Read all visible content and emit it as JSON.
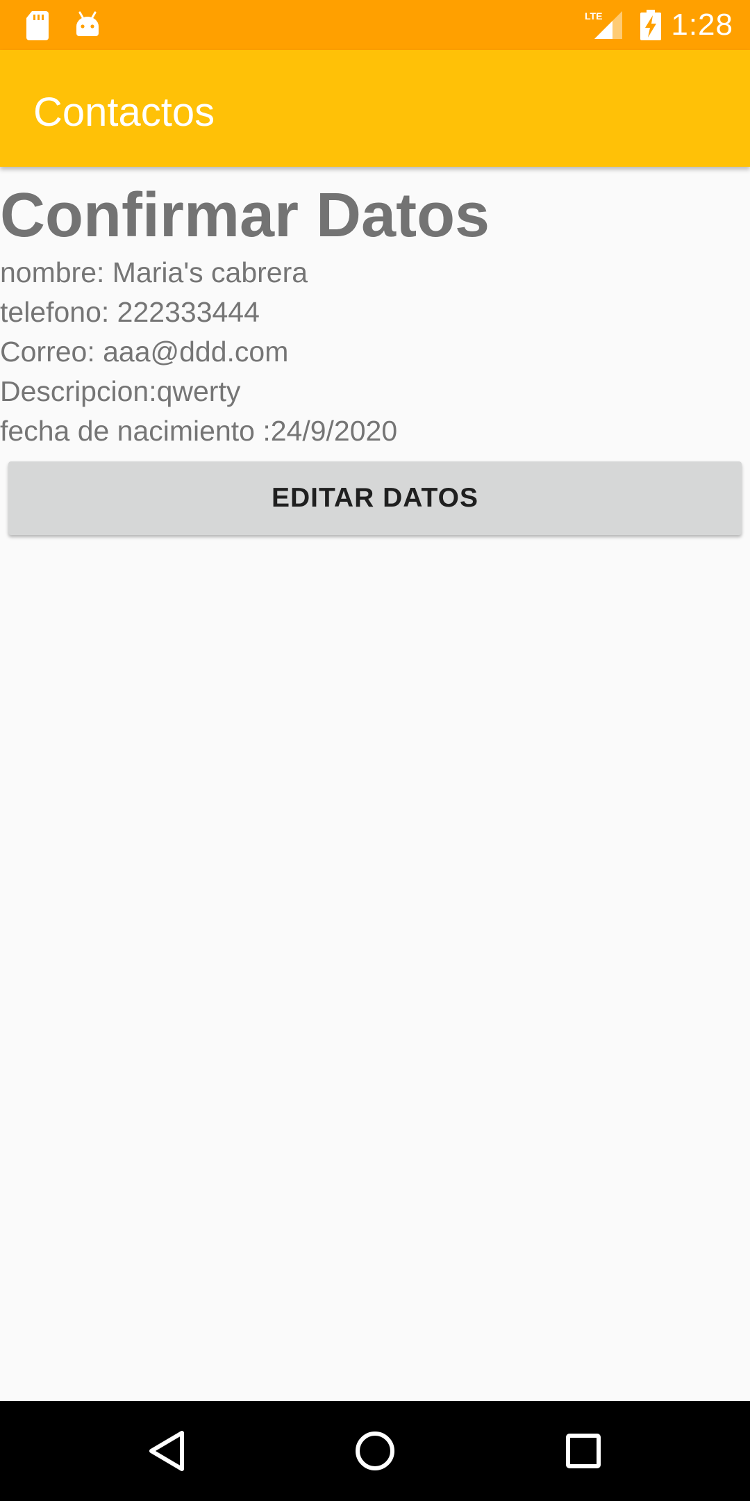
{
  "status_bar": {
    "time": "1:28",
    "network": "LTE",
    "icons": [
      "sd-card-icon",
      "android-icon",
      "lte-signal-icon",
      "battery-charging-icon"
    ],
    "background_color": "#ffa000"
  },
  "app_bar": {
    "title": "Contactos",
    "background_color": "#ffc107"
  },
  "main": {
    "heading": "Confirmar Datos",
    "lines": [
      "nombre: Maria's cabrera",
      "telefono: 222333444",
      "Correo: aaa@ddd.com",
      "Descripcion:qwerty",
      "fecha de nacimiento :24/9/2020"
    ],
    "edit_button_label": "EDITAR DATOS"
  },
  "nav_bar": {
    "buttons": [
      "back-icon",
      "home-icon",
      "recents-icon"
    ]
  }
}
